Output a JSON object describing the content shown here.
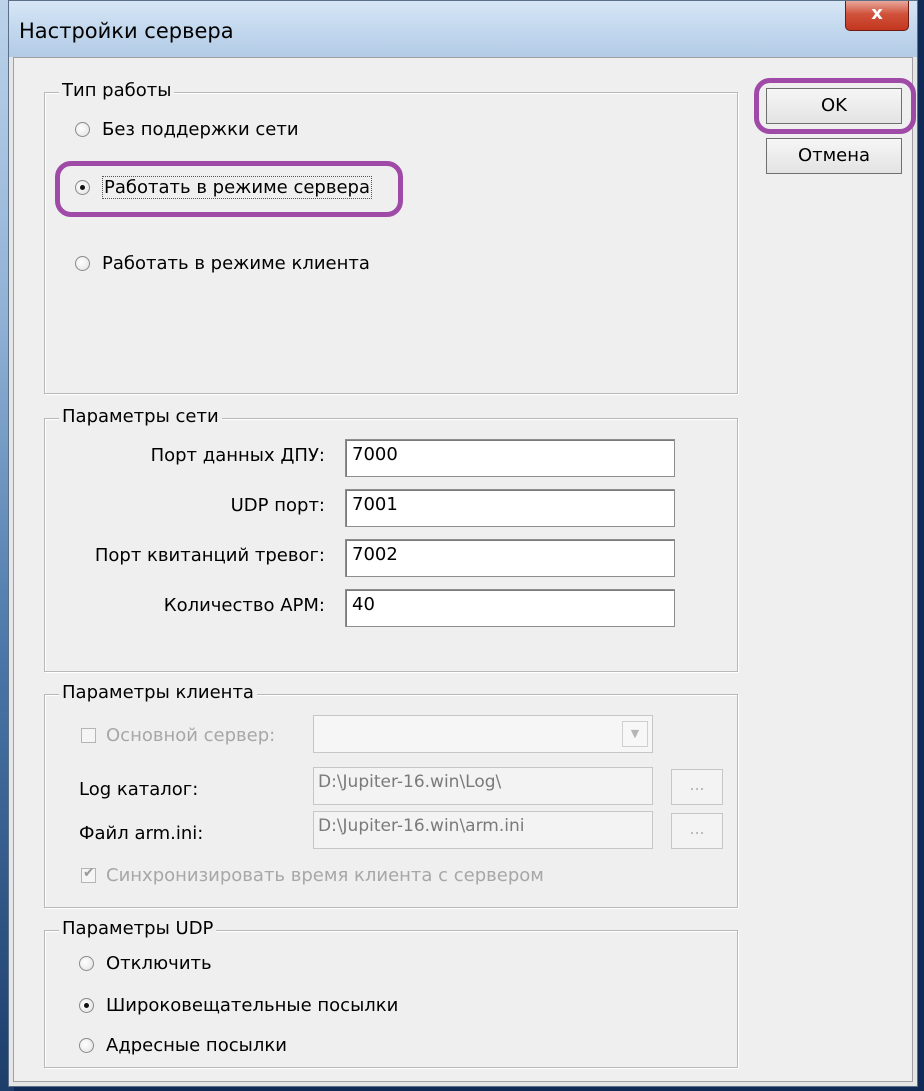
{
  "window": {
    "title": "Настройки сервера",
    "close_label": "x"
  },
  "buttons": {
    "ok": "OK",
    "cancel": "Отмена"
  },
  "work_mode": {
    "title": "Тип работы",
    "options": [
      {
        "label": "Без поддержки сети",
        "selected": false
      },
      {
        "label": "Работать в режиме сервера",
        "selected": true
      },
      {
        "label": "Работать в режиме клиента",
        "selected": false
      }
    ]
  },
  "network": {
    "title": "Параметры сети",
    "fields": [
      {
        "label": "Порт данных ДПУ:",
        "value": "7000"
      },
      {
        "label": "UDP порт:",
        "value": "7001"
      },
      {
        "label": "Порт квитанций тревог:",
        "value": "7002"
      },
      {
        "label": "Количество АРМ:",
        "value": "40"
      }
    ]
  },
  "client": {
    "title": "Параметры клиента",
    "main_server_label": "Основной сервер:",
    "main_server_checked": false,
    "main_server_value": "",
    "log_label": "Log каталог:",
    "log_value": "D:\\Jupiter-16.win\\Log\\",
    "arm_label": "Файл arm.ini:",
    "arm_value": "D:\\Jupiter-16.win\\arm.ini",
    "browse_label": "...",
    "sync_label": "Синхронизировать время клиента с сервером",
    "sync_checked": true
  },
  "udp": {
    "title": "Параметры UDP",
    "options": [
      {
        "label": "Отключить",
        "selected": false
      },
      {
        "label": "Широковещательные посылки",
        "selected": true
      },
      {
        "label": "Адресные посылки",
        "selected": false
      }
    ]
  },
  "colors": {
    "highlight": "#a04aa7"
  }
}
